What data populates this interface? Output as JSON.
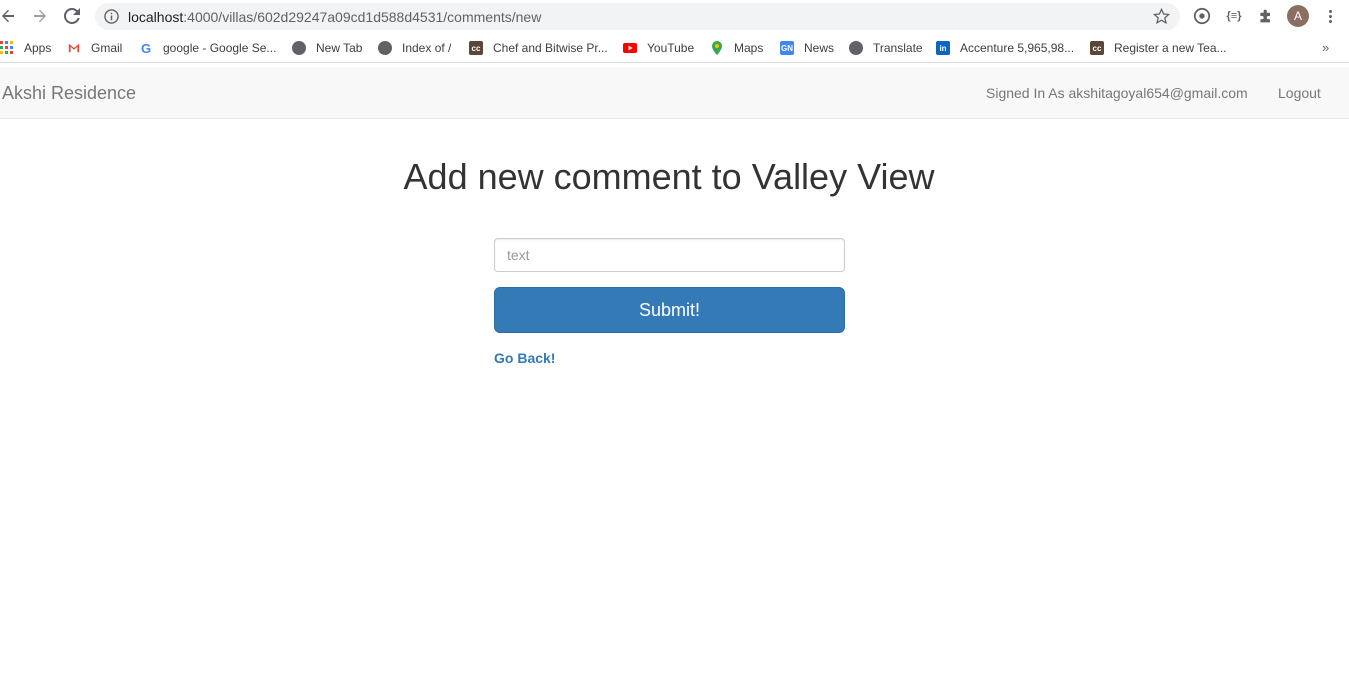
{
  "browser": {
    "url_host": "localhost",
    "url_path": ":4000/villas/602d29247a09cd1d588d4531/comments/new",
    "avatar_letter": "A",
    "ext_label": "{≡}"
  },
  "bookmarks": [
    {
      "label": "Apps",
      "icon": "apps-grid-icon",
      "color": "#4285f4"
    },
    {
      "label": "Gmail",
      "icon": "gmail-icon",
      "color": "#ea4335"
    },
    {
      "label": "google - Google Se...",
      "icon": "google-icon",
      "color": "#4285f4"
    },
    {
      "label": "New Tab",
      "icon": "globe-icon",
      "color": "#5f6368"
    },
    {
      "label": "Index of /",
      "icon": "globe-icon",
      "color": "#5f6368"
    },
    {
      "label": "Chef and Bitwise Pr...",
      "icon": "codechef-icon",
      "color": "#5b4638"
    },
    {
      "label": "YouTube",
      "icon": "youtube-icon",
      "color": "#ff0000"
    },
    {
      "label": "Maps",
      "icon": "maps-pin-icon",
      "color": "#34a853"
    },
    {
      "label": "News",
      "icon": "news-icon",
      "color": "#4285f4"
    },
    {
      "label": "Translate",
      "icon": "globe-icon",
      "color": "#5f6368"
    },
    {
      "label": "Accenture 5,965,98...",
      "icon": "linkedin-icon",
      "color": "#0a66c2"
    },
    {
      "label": "Register a new Tea...",
      "icon": "codechef-icon",
      "color": "#5b4638"
    }
  ],
  "navbar": {
    "brand": "Akshi Residence",
    "signed_in": "Signed In As akshitagoyal654@gmail.com",
    "logout": "Logout"
  },
  "main": {
    "title": "Add new comment to Valley View",
    "input_placeholder": "text",
    "input_value": "",
    "submit_label": "Submit!",
    "back_link": "Go Back!"
  },
  "colors": {
    "primary": "#337ab7",
    "navbar_bg": "#f8f8f8"
  }
}
